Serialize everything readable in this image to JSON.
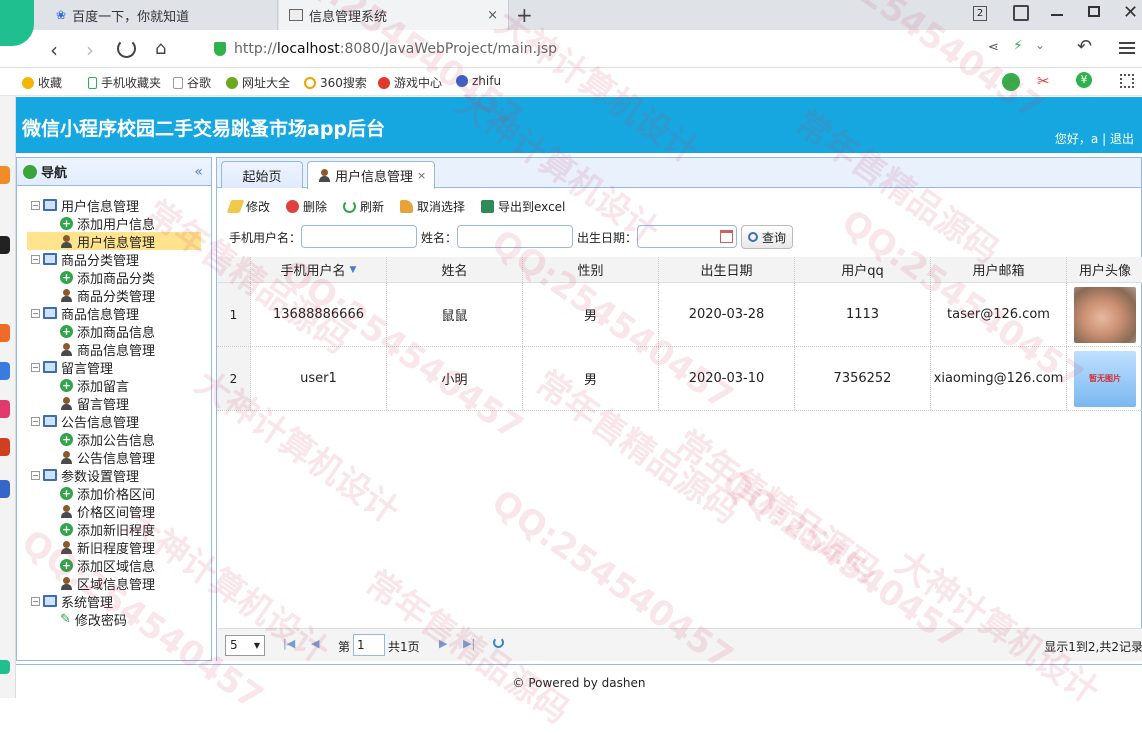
{
  "browser": {
    "tabs": [
      {
        "label": "百度一下，你就知道",
        "icon": "baidu-paw-icon"
      },
      {
        "label": "信息管理系统",
        "icon": "page-icon"
      }
    ],
    "new_tab": "+",
    "tab_count": "2",
    "url_prefix": "http://",
    "url_host": "localhost",
    "url_rest": ":8080/JavaWebProject/main.jsp",
    "bookmarks": [
      "收藏",
      "手机收藏夹",
      "谷歌",
      "网址大全",
      "360搜索",
      "游戏中心",
      "zhifu"
    ]
  },
  "header": {
    "title": "微信小程序校园二手交易跳蚤市场app后台",
    "greeting": "您好，a",
    "separator": "|",
    "logout": "退出"
  },
  "nav": {
    "title": "导航",
    "collapse": "«",
    "groups": [
      {
        "label": "用户信息管理",
        "items": [
          {
            "label": "添加用户信息",
            "icon": "add"
          },
          {
            "label": "用户信息管理",
            "icon": "user",
            "selected": true
          }
        ]
      },
      {
        "label": "商品分类管理",
        "items": [
          {
            "label": "添加商品分类",
            "icon": "add"
          },
          {
            "label": "商品分类管理",
            "icon": "user"
          }
        ]
      },
      {
        "label": "商品信息管理",
        "items": [
          {
            "label": "添加商品信息",
            "icon": "add"
          },
          {
            "label": "商品信息管理",
            "icon": "user"
          }
        ]
      },
      {
        "label": "留言管理",
        "items": [
          {
            "label": "添加留言",
            "icon": "add"
          },
          {
            "label": "留言管理",
            "icon": "user"
          }
        ]
      },
      {
        "label": "公告信息管理",
        "items": [
          {
            "label": "添加公告信息",
            "icon": "add"
          },
          {
            "label": "公告信息管理",
            "icon": "user"
          }
        ]
      },
      {
        "label": "参数设置管理",
        "items": [
          {
            "label": "添加价格区间",
            "icon": "add"
          },
          {
            "label": "价格区间管理",
            "icon": "user"
          },
          {
            "label": "添加新旧程度",
            "icon": "add"
          },
          {
            "label": "新旧程度管理",
            "icon": "user"
          },
          {
            "label": "添加区域信息",
            "icon": "add"
          },
          {
            "label": "区域信息管理",
            "icon": "user"
          }
        ]
      },
      {
        "label": "系统管理",
        "items": [
          {
            "label": "修改密码",
            "icon": "pencil"
          }
        ]
      }
    ]
  },
  "tabs": {
    "home": "起始页",
    "active": "用户信息管理",
    "close": "×"
  },
  "toolbar": {
    "edit": "修改",
    "delete": "删除",
    "refresh": "刷新",
    "cancel_select": "取消选择",
    "export": "导出到excel"
  },
  "search": {
    "phone_label": "手机用户名：",
    "name_label": "姓名：",
    "birth_label": "出生日期：",
    "query": "查询"
  },
  "grid": {
    "columns": [
      "手机用户名",
      "姓名",
      "性别",
      "出生日期",
      "用户qq",
      "用户邮箱",
      "用户头像"
    ],
    "rows": [
      {
        "num": "1",
        "phone": "13688886666",
        "name": "鼠鼠",
        "gender": "男",
        "birth": "2020-03-28",
        "qq": "1113",
        "email": "taser@126.com",
        "avatar": "hamster-photo"
      },
      {
        "num": "2",
        "phone": "user1",
        "name": "小明",
        "gender": "男",
        "birth": "2020-03-10",
        "qq": "7356252",
        "email": "xiaoming@126.com",
        "avatar": "暂无图片"
      }
    ]
  },
  "pager": {
    "page_size": "5",
    "page_prefix": "第",
    "page": "1",
    "page_total": "共1页",
    "summary": "显示1到2,共2记录"
  },
  "footer": {
    "text": "© Powered by dashen"
  },
  "watermarks": [
    "QQ:254540457",
    "大神计算机设计",
    "常年售精品源码"
  ],
  "colors": {
    "header_bg": "#16a7e0",
    "border": "#95b8e7",
    "selected": "#ffe48d"
  }
}
